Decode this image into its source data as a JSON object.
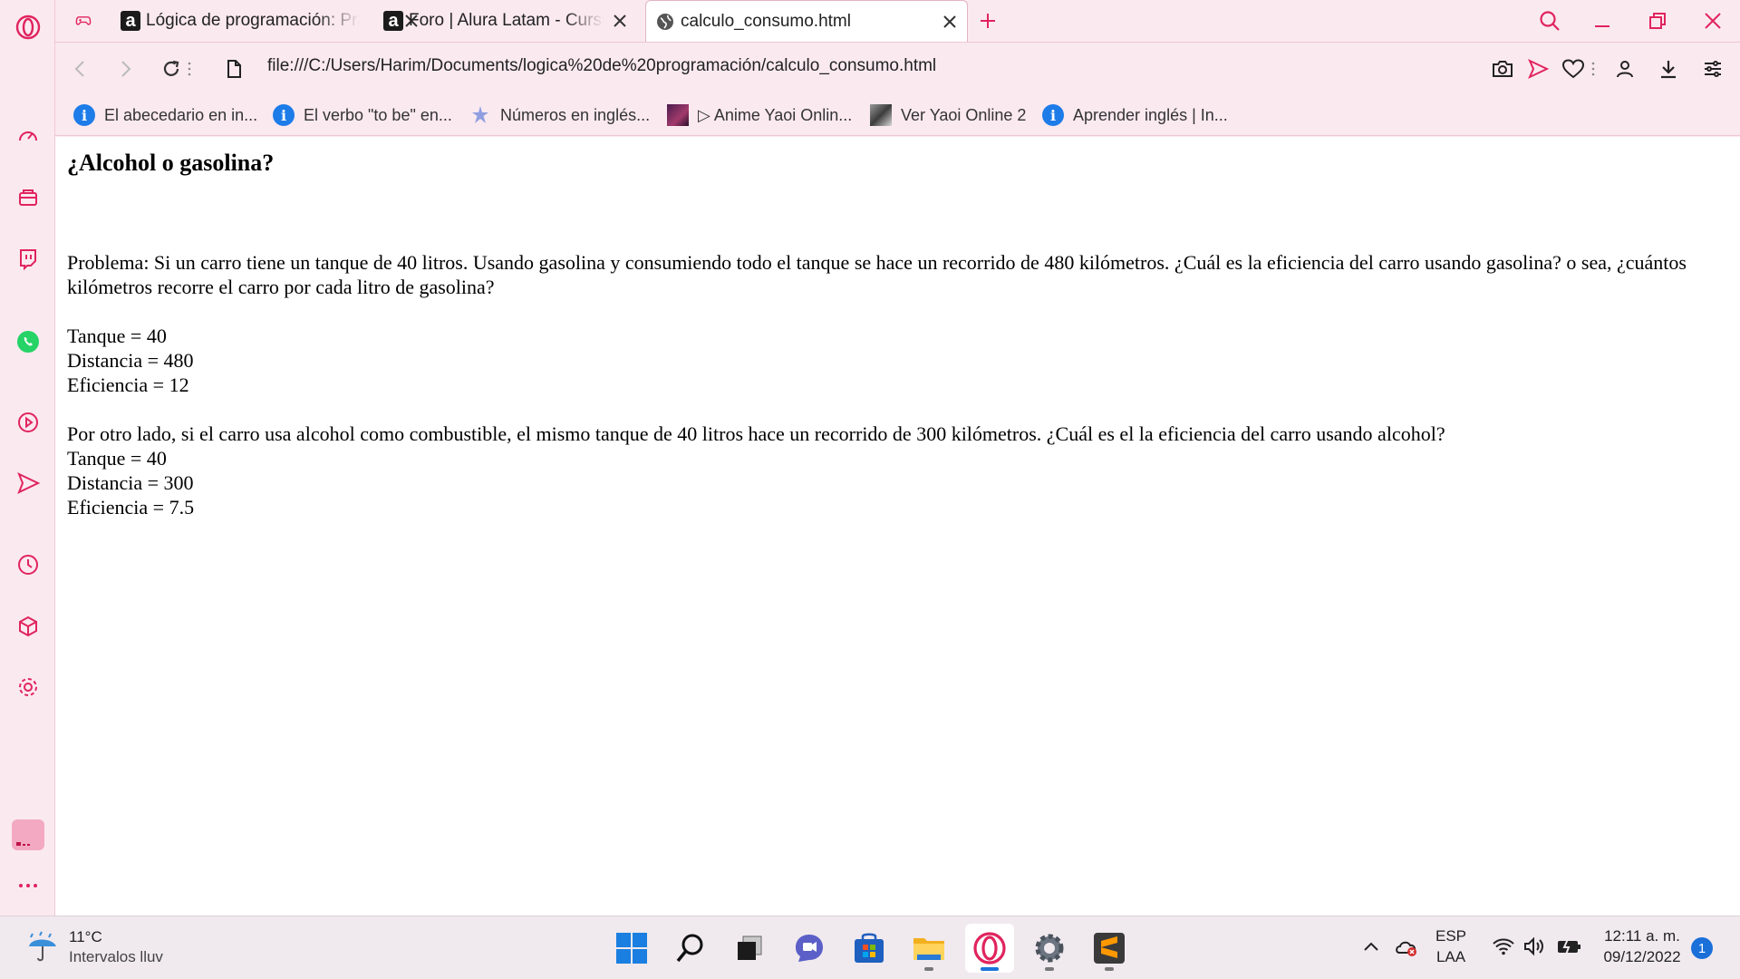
{
  "tabs": [
    {
      "label": "Lógica de programación: Práctica",
      "icon": "alura-icon"
    },
    {
      "label": "Foro | Alura Latam - Cursos",
      "icon": "alura-icon"
    },
    {
      "label": "calculo_consumo.html",
      "icon": "globe-icon"
    }
  ],
  "address": {
    "url": "file:///C:/Users/Harim/Documents/logica%20de%20programación/calculo_consumo.html"
  },
  "bookmarks": [
    {
      "label": "El abecedario en in..."
    },
    {
      "label": "El verbo \"to be\" en..."
    },
    {
      "label": "Números en inglés..."
    },
    {
      "label": "▷ Anime Yaoi Onlin..."
    },
    {
      "label": "Ver Yaoi Online 2"
    },
    {
      "label": "Aprender inglés | In..."
    }
  ],
  "page": {
    "title": "¿Alcohol o gasolina?",
    "problem": "Problema: Si un carro tiene un tanque de 40 litros. Usando gasolina y consumiendo todo el tanque se hace un recorrido de 480 kilómetros. ¿Cuál es la eficiencia del carro usando gasolina? o sea, ¿cuántos kilómetros recorre el carro por cada litro de gasolina?",
    "gas": {
      "tanque": "Tanque = 40",
      "distancia": "Distancia = 480",
      "eficiencia": "Eficiencia = 12"
    },
    "alcohol_intro": "Por otro lado, si el carro usa alcohol como combustible, el mismo tanque de 40 litros hace un recorrido de 300 kilómetros. ¿Cuál es el la eficiencia del carro usando alcohol?",
    "alcohol": {
      "tanque": "Tanque = 40",
      "distancia": "Distancia = 300",
      "eficiencia": "Eficiencia = 7.5"
    }
  },
  "taskbar": {
    "weather_temp": "11°C",
    "weather_desc": "Intervalos lluv",
    "lang_top": "ESP",
    "lang_bottom": "LAA",
    "time": "12:11 a. m.",
    "date": "09/12/2022",
    "notifications": "1"
  },
  "colors": {
    "accent": "#e0245e",
    "sidebar_bg": "#fbe9f0",
    "taskbar_bg": "#f0e9ee"
  }
}
